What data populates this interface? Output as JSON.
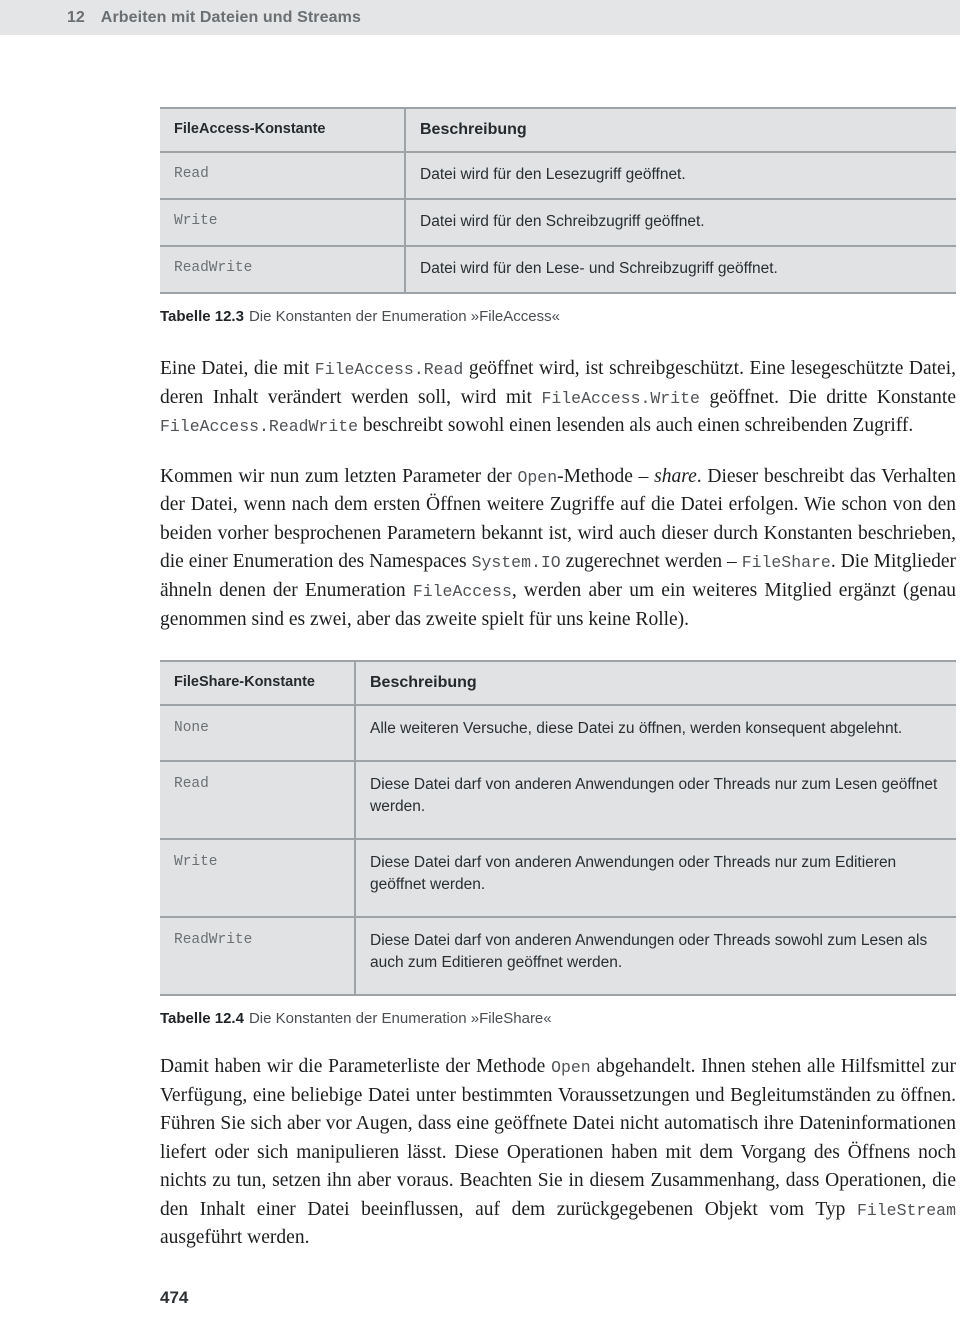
{
  "running_head": {
    "chapter_number": "12",
    "chapter_title": "Arbeiten mit Dateien und Streams"
  },
  "tables": [
    {
      "id": "table-fileaccess",
      "headers": [
        "FileAccess-Konstante",
        "Beschreibung"
      ],
      "rows": [
        {
          "constant": "Read",
          "description": "Datei wird für den Lesezugriff geöffnet."
        },
        {
          "constant": "Write",
          "description": "Datei wird für den Schreibzugriff geöffnet."
        },
        {
          "constant": "ReadWrite",
          "description": "Datei wird für den Lese- und Schreibzugriff geöffnet."
        }
      ],
      "caption_label": "Tabelle 12.3",
      "caption_text": "Die Konstanten der Enumeration »FileAccess«"
    },
    {
      "id": "table-fileshare",
      "headers": [
        "FileShare-Konstante",
        "Beschreibung"
      ],
      "rows": [
        {
          "constant": "None",
          "description": "Alle weiteren Versuche, diese Datei zu öffnen, werden konsequent abgelehnt."
        },
        {
          "constant": "Read",
          "description": "Diese Datei darf von anderen Anwendungen oder Threads nur zum Lesen geöffnet werden."
        },
        {
          "constant": "Write",
          "description": "Diese Datei darf von anderen Anwendungen oder Threads nur zum Editieren geöffnet werden."
        },
        {
          "constant": "ReadWrite",
          "description": "Diese Datei darf von anderen Anwendungen oder Threads sowohl zum Lesen als auch zum Editieren geöffnet werden."
        }
      ],
      "caption_label": "Tabelle 12.4",
      "caption_text": "Die Konstanten der Enumeration »FileShare«"
    }
  ],
  "paragraphs": {
    "p1": {
      "s1": "Eine Datei, die mit ",
      "c1": "FileAccess.Read",
      "s2": " geöffnet wird, ist schreibgeschützt. Eine lesegeschützte Datei, deren Inhalt verändert werden soll, wird mit ",
      "c2": "FileAccess.Write",
      "s3": " geöffnet. Die dritte Konstante ",
      "c3": "FileAccess.ReadWrite",
      "s4": " beschreibt sowohl einen lesenden als auch einen schreibenden Zugriff."
    },
    "p2": {
      "s1": "Kommen wir nun zum letzten Parameter der ",
      "c1": "Open",
      "s2": "-Methode – ",
      "i1": "share",
      "s3": ". Dieser beschreibt das Verhalten der Datei, wenn nach dem ersten Öffnen weitere Zugriffe auf die Datei erfolgen. Wie schon von den beiden vorher besprochenen Parametern bekannt ist, wird auch dieser durch Konstanten beschrieben, die einer Enumeration des Namespaces ",
      "c2": "System.IO",
      "s4": " zugerechnet werden – ",
      "c3": "FileShare",
      "s5": ". Die Mitglieder ähneln denen der Enumeration ",
      "c4": "FileAccess",
      "s6": ", werden aber um ein weiteres Mitglied ergänzt (genau genommen sind es zwei, aber das zweite spielt für uns keine Rolle)."
    },
    "p3": {
      "s1": "Damit haben wir die Parameterliste der Methode ",
      "c1": "Open",
      "s2": " abgehandelt. Ihnen stehen alle Hilfsmittel zur Verfügung, eine beliebige Datei unter bestimmten Voraussetzungen und Begleitumständen zu öffnen. Führen Sie sich aber vor Augen, dass eine geöffnete Datei nicht automatisch ihre Dateninformationen liefert oder sich manipulieren lässt. Diese Operationen haben mit dem Vorgang des Öffnens noch nichts zu tun, setzen ihn aber voraus. Beachten Sie in diesem Zusammenhang, dass Operationen, die den Inhalt einer Datei beeinflussen, auf dem zurückgegebenen Objekt vom Typ ",
      "c2": "FileStream",
      "s3": " ausgeführt werden."
    }
  },
  "folio": "474",
  "colors": {
    "running_head_band": "#e3e5e6",
    "table_fill": "#e0e2e4",
    "table_rule": "#9ea3a7",
    "code_text": "#6c7073",
    "body_text": "#1b1d1f"
  }
}
